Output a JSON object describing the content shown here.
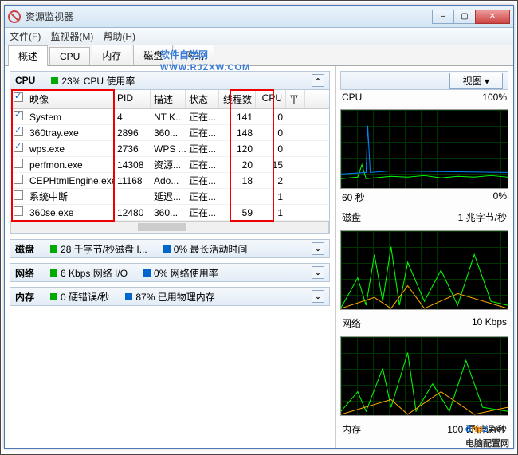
{
  "window": {
    "title": "资源监视器"
  },
  "menu": {
    "file": "文件(F)",
    "monitor": "监视器(M)",
    "help": "帮助(H)"
  },
  "tabs": {
    "overview": "概述",
    "cpu": "CPU",
    "memory": "内存",
    "disk": "磁盘",
    "network": "网络"
  },
  "cpu_section": {
    "title": "CPU",
    "usage": "23% CPU 使用率",
    "columns": {
      "image": "映像",
      "pid": "PID",
      "desc": "描述",
      "status": "状态",
      "threads": "线程数",
      "cpu": "CPU",
      "pf": "平"
    },
    "rows": [
      {
        "chk": true,
        "image": "System",
        "pid": "4",
        "desc": "NT K...",
        "status": "正在...",
        "threads": "141",
        "cpu": "0"
      },
      {
        "chk": true,
        "image": "360tray.exe",
        "pid": "2896",
        "desc": "360...",
        "status": "正在...",
        "threads": "148",
        "cpu": "0"
      },
      {
        "chk": true,
        "image": "wps.exe",
        "pid": "2736",
        "desc": "WPS ...",
        "status": "正在...",
        "threads": "120",
        "cpu": "0"
      },
      {
        "chk": false,
        "image": "perfmon.exe",
        "pid": "14308",
        "desc": "资源...",
        "status": "正在...",
        "threads": "20",
        "cpu": "15"
      },
      {
        "chk": false,
        "image": "CEPHtmlEngine.exe",
        "pid": "11168",
        "desc": "Ado...",
        "status": "正在...",
        "threads": "18",
        "cpu": "2"
      },
      {
        "chk": false,
        "image": "系统中断",
        "pid": "",
        "desc": "延迟...",
        "status": "正在...",
        "threads": "",
        "cpu": "1"
      },
      {
        "chk": false,
        "image": "360se.exe",
        "pid": "12480",
        "desc": "360...",
        "status": "正在...",
        "threads": "59",
        "cpu": "1"
      }
    ]
  },
  "disk_section": {
    "title": "磁盘",
    "stat1": "28 千字节/秒磁盘 I...",
    "stat2": "0% 最长活动时间"
  },
  "network_section": {
    "title": "网络",
    "stat1": "6 Kbps 网络 I/O",
    "stat2": "0% 网络使用率"
  },
  "memory_section": {
    "title": "内存",
    "stat1": "0 硬错误/秒",
    "stat2": "87% 已用物理内存"
  },
  "right": {
    "view_btn": "视图",
    "graphs": {
      "cpu": {
        "left": "CPU",
        "right": "100%",
        "footer_left": "60 秒",
        "footer_right": "0%"
      },
      "disk": {
        "left": "磁盘",
        "right": "1 兆字节/秒"
      },
      "network": {
        "left": "网络",
        "right": "10 Kbps"
      },
      "memory": {
        "left": "内存",
        "right": "100 硬错误/秒"
      }
    }
  },
  "watermarks": {
    "w1_main": "软件自学网",
    "w1_sub": "WWW.RJZXW.COM",
    "w2_net": "电脑配置网"
  }
}
